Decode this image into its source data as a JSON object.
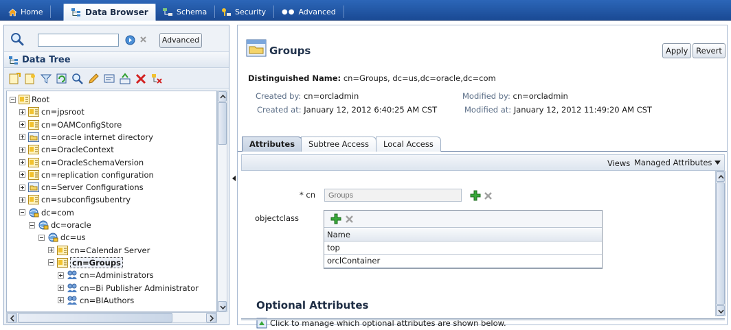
{
  "top_tabs": [
    {
      "label": "Home",
      "icon": "home-icon"
    },
    {
      "label": "Data Browser",
      "icon": "tree-icon",
      "active": true
    },
    {
      "label": "Schema",
      "icon": "schema-icon"
    },
    {
      "label": "Security",
      "icon": "key-icon"
    },
    {
      "label": "Advanced",
      "icon": "dots-icon"
    }
  ],
  "left": {
    "search_value": "",
    "advanced_label": "Advanced",
    "tree_title": "Data Tree",
    "tree_nodes": [
      {
        "label": "Root",
        "level": 0,
        "expander": "minus",
        "icon": "entry"
      },
      {
        "label": "cn=jpsroot",
        "level": 1,
        "expander": "plus",
        "icon": "entry"
      },
      {
        "label": "cn=OAMConfigStore",
        "level": 1,
        "expander": "plus",
        "icon": "entry"
      },
      {
        "label": "cn=oracle internet directory",
        "level": 1,
        "expander": "plus",
        "icon": "folder"
      },
      {
        "label": "cn=OracleContext",
        "level": 1,
        "expander": "plus",
        "icon": "entry"
      },
      {
        "label": "cn=OracleSchemaVersion",
        "level": 1,
        "expander": "plus",
        "icon": "entry"
      },
      {
        "label": "cn=replication configuration",
        "level": 1,
        "expander": "plus",
        "icon": "entry"
      },
      {
        "label": "cn=Server Configurations",
        "level": 1,
        "expander": "plus",
        "icon": "folder"
      },
      {
        "label": "cn=subconfigsubentry",
        "level": 1,
        "expander": "plus",
        "icon": "entry"
      },
      {
        "label": "dc=com",
        "level": 1,
        "expander": "minus",
        "icon": "domain"
      },
      {
        "label": "dc=oracle",
        "level": 2,
        "expander": "minus",
        "icon": "domain"
      },
      {
        "label": "dc=us",
        "level": 3,
        "expander": "minus",
        "icon": "domain"
      },
      {
        "label": "cn=Calendar Server",
        "level": 4,
        "expander": "plus",
        "icon": "entry"
      },
      {
        "label": "cn=Groups",
        "level": 4,
        "expander": "minus",
        "icon": "entry",
        "selected": true
      },
      {
        "label": "cn=Administrators",
        "level": 5,
        "expander": "plus",
        "icon": "group"
      },
      {
        "label": "cn=Bi Publisher Administrator",
        "level": 5,
        "expander": "plus",
        "icon": "group"
      },
      {
        "label": "cn=BIAuthors",
        "level": 5,
        "expander": "plus",
        "icon": "group"
      }
    ]
  },
  "right": {
    "title": "Groups",
    "apply_label": "Apply",
    "revert_label": "Revert",
    "dn_label": "Distinguished Name:",
    "dn_value": "cn=Groups, dc=us,dc=oracle,dc=com",
    "created_by_label": "Created by:",
    "created_by_value": "cn=orcladmin",
    "created_at_label": "Created at:",
    "created_at_value": "January 12, 2012 6:40:25 AM CST",
    "modified_by_label": "Modified by:",
    "modified_by_value": "cn=orcladmin",
    "modified_at_label": "Modified at:",
    "modified_at_value": "January 12, 2012 11:49:20 AM CST",
    "tabs": [
      {
        "label": "Attributes",
        "active": true
      },
      {
        "label": "Subtree Access"
      },
      {
        "label": "Local Access"
      }
    ],
    "views_label": "Views",
    "views_value": "Managed Attributes",
    "cn_label": "* cn",
    "cn_placeholder": "Groups",
    "objectclass_label": "objectclass",
    "oc_header": "Name",
    "oc_values": [
      "top",
      "orclContainer"
    ],
    "optional_title": "Optional Attributes",
    "optional_note": "Click to manage which optional attributes are shown below."
  },
  "colors": {
    "topbar": "#1f55a5",
    "accent_green": "#2e9e2e",
    "panel_bg": "#eef2f7"
  }
}
